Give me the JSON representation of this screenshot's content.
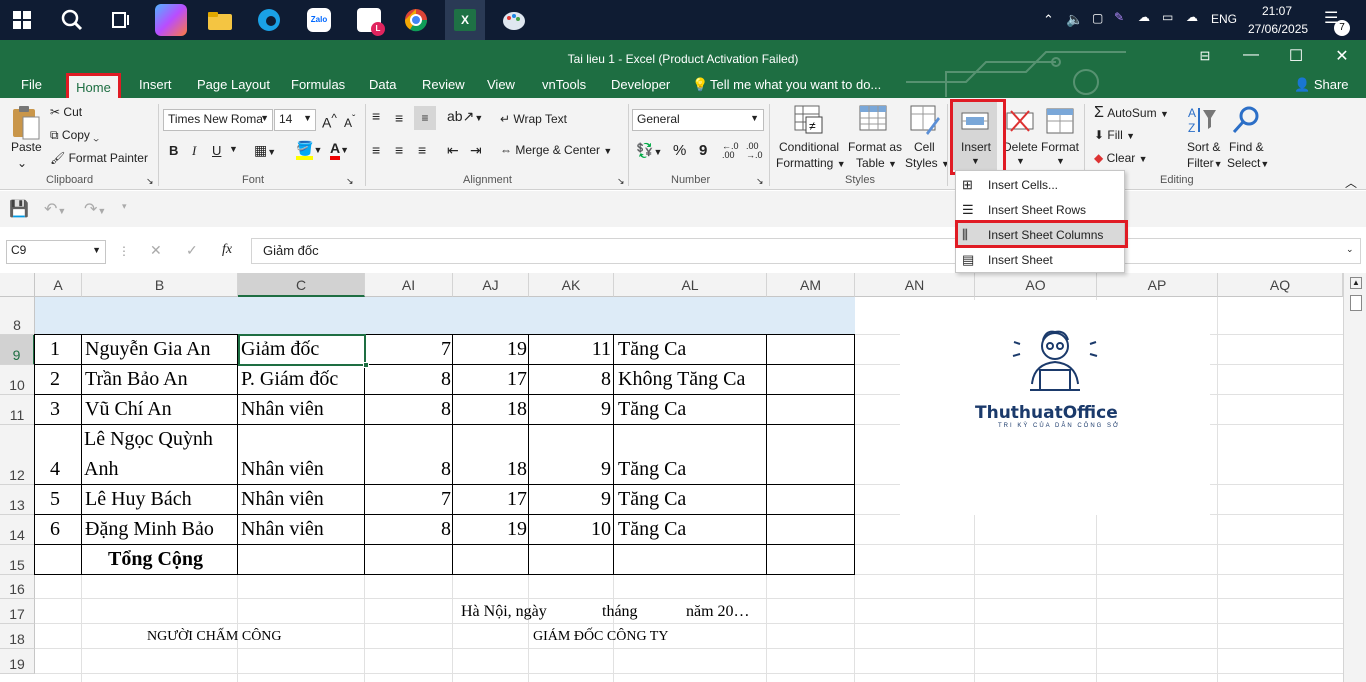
{
  "taskbar": {
    "time": "21:07",
    "date": "27/06/2025",
    "lang": "ENG",
    "notif_count": "7"
  },
  "window": {
    "title": "Tai lieu 1 - Excel (Product Activation Failed)",
    "share_label": "Share"
  },
  "tabs": [
    "File",
    "Home",
    "Insert",
    "Page Layout",
    "Formulas",
    "Data",
    "Review",
    "View",
    "vnTools",
    "Developer"
  ],
  "tell_me": "Tell me what you want to do...",
  "ribbon": {
    "clipboard": {
      "paste": "Paste",
      "cut": "Cut",
      "copy": "Copy",
      "format_painter": "Format Painter",
      "group": "Clipboard"
    },
    "font": {
      "name": "Times New Roma",
      "size": "14",
      "bold": "B",
      "italic": "I",
      "underline": "U",
      "group": "Font"
    },
    "alignment": {
      "wrap": "Wrap Text",
      "merge": "Merge & Center",
      "group": "Alignment"
    },
    "number": {
      "format": "General",
      "percent": "%",
      "comma": "9",
      "group": "Number"
    },
    "styles": {
      "conditional": "Conditional",
      "formatting": "Formatting",
      "format_as": "Format as",
      "table": "Table",
      "cell": "Cell",
      "cell_styles": "Styles",
      "group": "Styles"
    },
    "cells": {
      "insert": "Insert",
      "delete": "Delete",
      "format": "Format"
    },
    "editing": {
      "autosum": "AutoSum",
      "fill": "Fill",
      "clear": "Clear",
      "sort": "Sort &",
      "filter": "Filter",
      "find": "Find &",
      "select": "Select",
      "group": "Editing"
    }
  },
  "name_box": "C9",
  "formula": "Giảm đốc",
  "fx": "fx",
  "columns": [
    "A",
    "B",
    "C",
    "AI",
    "AJ",
    "AK",
    "AL",
    "AM",
    "AN",
    "AO",
    "AP",
    "AQ"
  ],
  "rows": [
    "8",
    "9",
    "10",
    "11",
    "12",
    "13",
    "14",
    "15",
    "16",
    "17",
    "18",
    "19"
  ],
  "data": [
    {
      "a": "1",
      "b": "Nguyễn Gia An",
      "c": "Giảm đốc",
      "ai": "7",
      "aj": "19",
      "ak": "11",
      "al": "Tăng Ca"
    },
    {
      "a": "2",
      "b": "Trần Bảo An",
      "c": "P. Giám đốc",
      "ai": "8",
      "aj": "17",
      "ak": "8",
      "al": "Không Tăng Ca"
    },
    {
      "a": "3",
      "b": "Vũ Chí An",
      "c": "Nhân viên",
      "ai": "8",
      "aj": "18",
      "ak": "9",
      "al": "Tăng Ca"
    },
    {
      "a": "4",
      "b1": "Lê Ngọc Quỳnh",
      "b2": "Anh",
      "c": "Nhân viên",
      "ai": "8",
      "aj": "18",
      "ak": "9",
      "al": "Tăng Ca"
    },
    {
      "a": "5",
      "b": "Lê Huy Bách",
      "c": "Nhân viên",
      "ai": "7",
      "aj": "17",
      "ak": "9",
      "al": "Tăng Ca"
    },
    {
      "a": "6",
      "b": "Đặng Minh Bảo",
      "c": "Nhân viên",
      "ai": "8",
      "aj": "19",
      "ak": "10",
      "al": "Tăng Ca"
    }
  ],
  "total": "Tổng Cộng",
  "footer": {
    "place": "Hà Nội, ngày",
    "month": "tháng",
    "year": "năm 20…",
    "timekeeper": "NGƯỜI CHẤM CÔNG",
    "director": "GIÁM ĐỐC CÔNG TY"
  },
  "logo": {
    "name": "ThuthuatOffice",
    "tagline": "TRI KỲ CỦA DÂN CÔNG SỞ"
  },
  "insert_menu": [
    "Insert Cells...",
    "Insert Sheet Rows",
    "Insert Sheet Columns",
    "Insert Sheet"
  ],
  "colors": {
    "excel_green": "#1e6e42",
    "highlight": "#e01b24",
    "header_fill": "#ddebf7"
  }
}
